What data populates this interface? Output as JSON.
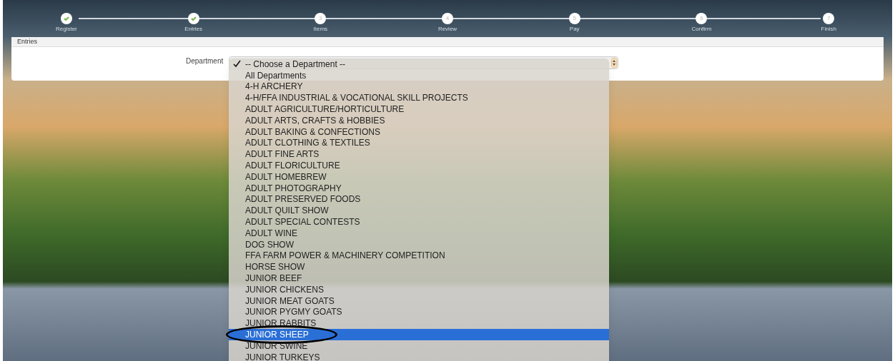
{
  "steps": [
    {
      "label": "Register",
      "done": true
    },
    {
      "label": "Entries",
      "done": true
    },
    {
      "label": "Items",
      "number": "3",
      "done": false
    },
    {
      "label": "Review",
      "number": "4",
      "done": false
    },
    {
      "label": "Pay",
      "number": "5",
      "done": false
    },
    {
      "label": "Confirm",
      "number": "6",
      "done": false
    },
    {
      "label": "Finish",
      "number": "7",
      "done": false
    }
  ],
  "panel": {
    "title": "Entries",
    "field_label": "Department"
  },
  "dropdown": {
    "options": [
      {
        "label": "-- Choose a Department --",
        "checked": true,
        "selected": false
      },
      {
        "label": "All Departments",
        "checked": false,
        "selected": false
      },
      {
        "label": "4-H ARCHERY",
        "checked": false,
        "selected": false
      },
      {
        "label": "4-H/FFA INDUSTRIAL & VOCATIONAL SKILL PROJECTS",
        "checked": false,
        "selected": false
      },
      {
        "label": "ADULT AGRICULTURE/HORTICULTURE",
        "checked": false,
        "selected": false
      },
      {
        "label": "ADULT ARTS, CRAFTS & HOBBIES",
        "checked": false,
        "selected": false
      },
      {
        "label": "ADULT BAKING & CONFECTIONS",
        "checked": false,
        "selected": false
      },
      {
        "label": "ADULT CLOTHING & TEXTILES",
        "checked": false,
        "selected": false
      },
      {
        "label": "ADULT FINE ARTS",
        "checked": false,
        "selected": false
      },
      {
        "label": "ADULT FLORICULTURE",
        "checked": false,
        "selected": false
      },
      {
        "label": "ADULT HOMEBREW",
        "checked": false,
        "selected": false
      },
      {
        "label": "ADULT PHOTOGRAPHY",
        "checked": false,
        "selected": false
      },
      {
        "label": "ADULT PRESERVED FOODS",
        "checked": false,
        "selected": false
      },
      {
        "label": "ADULT QUILT SHOW",
        "checked": false,
        "selected": false
      },
      {
        "label": "ADULT SPECIAL CONTESTS",
        "checked": false,
        "selected": false
      },
      {
        "label": "ADULT WINE",
        "checked": false,
        "selected": false
      },
      {
        "label": "DOG SHOW",
        "checked": false,
        "selected": false
      },
      {
        "label": "FFA FARM POWER & MACHINERY COMPETITION",
        "checked": false,
        "selected": false
      },
      {
        "label": "HORSE SHOW",
        "checked": false,
        "selected": false
      },
      {
        "label": "JUNIOR BEEF",
        "checked": false,
        "selected": false
      },
      {
        "label": "JUNIOR CHICKENS",
        "checked": false,
        "selected": false
      },
      {
        "label": "JUNIOR MEAT GOATS",
        "checked": false,
        "selected": false
      },
      {
        "label": "JUNIOR PYGMY GOATS",
        "checked": false,
        "selected": false
      },
      {
        "label": "JUNIOR RABBITS",
        "checked": false,
        "selected": false
      },
      {
        "label": "JUNIOR SHEEP",
        "checked": false,
        "selected": true,
        "circled": true
      },
      {
        "label": "JUNIOR SWINE",
        "checked": false,
        "selected": false
      },
      {
        "label": "JUNIOR TURKEYS",
        "checked": false,
        "selected": false
      }
    ]
  }
}
